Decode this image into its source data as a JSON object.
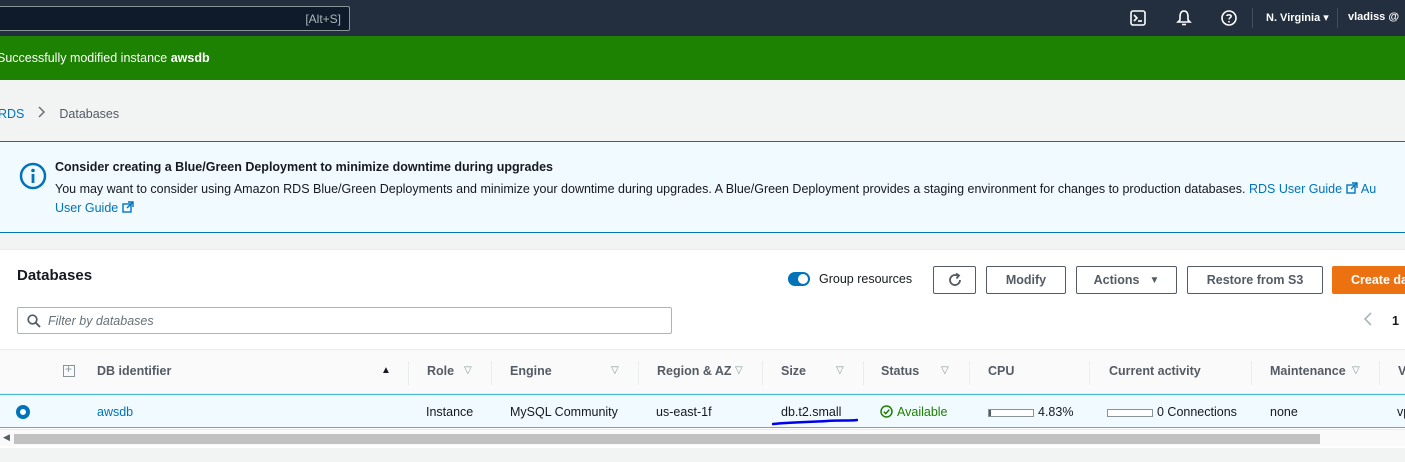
{
  "topnav": {
    "search_shortcut": "[Alt+S]",
    "icons": [
      "cloudshell-icon",
      "bell-icon",
      "help-icon"
    ],
    "region": "N. Virginia ▾",
    "user": "vladiss @"
  },
  "flash": {
    "prefix": "Successfully modified instance ",
    "instance": "awsdb",
    "color": "#1d8102"
  },
  "breadcrumb": {
    "root": "RDS",
    "current": "Databases"
  },
  "alert": {
    "title": "Consider creating a Blue/Green Deployment to minimize downtime during upgrades",
    "body": "You may want to consider using Amazon RDS Blue/Green Deployments and minimize your downtime during upgrades. A Blue/Green Deployment provides a staging environment for changes to production databases.",
    "link1": "RDS User Guide",
    "link2_partial": "Au",
    "link2_rest": "User Guide"
  },
  "panel": {
    "title": "Databases",
    "group_toggle_label": "Group resources",
    "group_toggle_on": true,
    "buttons": {
      "modify": "Modify",
      "actions": "Actions",
      "restore": "Restore from S3",
      "create": "Create da"
    },
    "filter_placeholder": "Filter by databases",
    "page": "1"
  },
  "table": {
    "columns": {
      "db_identifier": "DB identifier",
      "role": "Role",
      "engine": "Engine",
      "region_az": "Region & AZ",
      "size": "Size",
      "status": "Status",
      "cpu": "CPU",
      "current_activity": "Current activity",
      "maintenance": "Maintenance",
      "vpc_partial": "V"
    },
    "rows": [
      {
        "db_identifier": "awsdb",
        "role": "Instance",
        "engine": "MySQL Community",
        "region_az": "us-east-1f",
        "size": "db.t2.small",
        "status": "Available",
        "cpu": "4.83%",
        "cpu_fraction": 0.0483,
        "current_activity": "0 Connections",
        "activity_fraction": 0,
        "maintenance": "none",
        "vpc_partial": "vp"
      }
    ]
  },
  "colors": {
    "nav_bg": "#232f3e",
    "link": "#0073bb",
    "primary_button": "#ec7211",
    "annotation_underline": "#0000ee"
  }
}
